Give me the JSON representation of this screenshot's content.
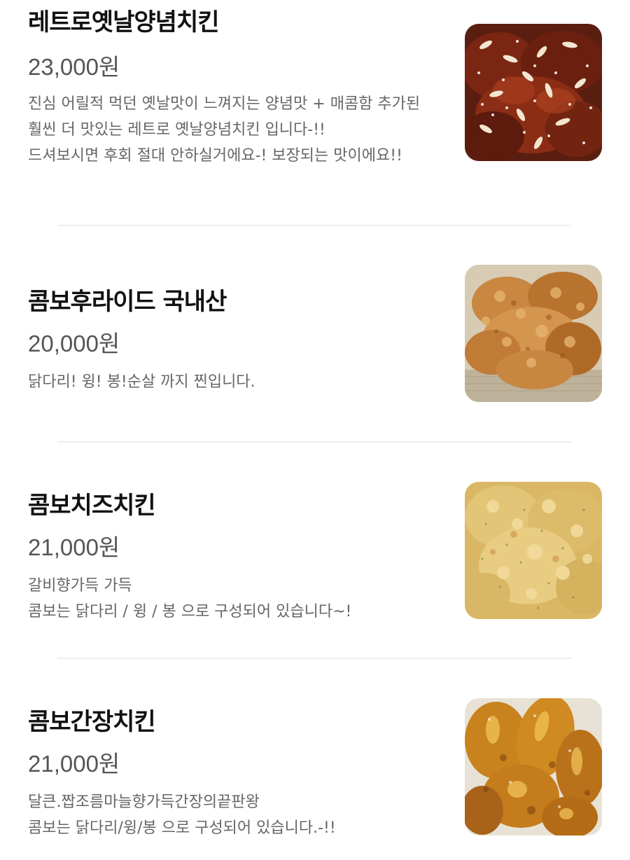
{
  "menu": {
    "items": [
      {
        "name": "레트로옛날양념치킨",
        "price": "23,000원",
        "description": [
          "진심 어릴적 먹던 옛날맛이 느껴지는 양념맛 + 매콤함 추가된",
          "훨씬 더 맛있는 레트로 옛날양념치킨 입니다-!!",
          "드셔보시면 후회 절대 안하실거에요-! 보장되는 맛이에요!!"
        ],
        "image": "seasoned-chicken-photo"
      },
      {
        "name": "콤보후라이드 국내산",
        "price": "20,000원",
        "description": [
          "닭다리! 윙! 봉!순살 까지 찐입니다."
        ],
        "image": "fried-chicken-photo"
      },
      {
        "name": "콤보치즈치킨",
        "price": "21,000원",
        "description": [
          "갈비향가득 가득",
          "콤보는 닭다리 / 윙 / 봉 으로 구성되어 있습니다~!"
        ],
        "image": "cheese-chicken-photo"
      },
      {
        "name": "콤보간장치킨",
        "price": "21,000원",
        "description": [
          "달큰.짭조름마늘향가득간장의끝판왕",
          "콤보는 닭다리/윙/봉 으로 구성되어 있습니다.-!!"
        ],
        "image": "soy-garlic-chicken-photo"
      }
    ]
  }
}
